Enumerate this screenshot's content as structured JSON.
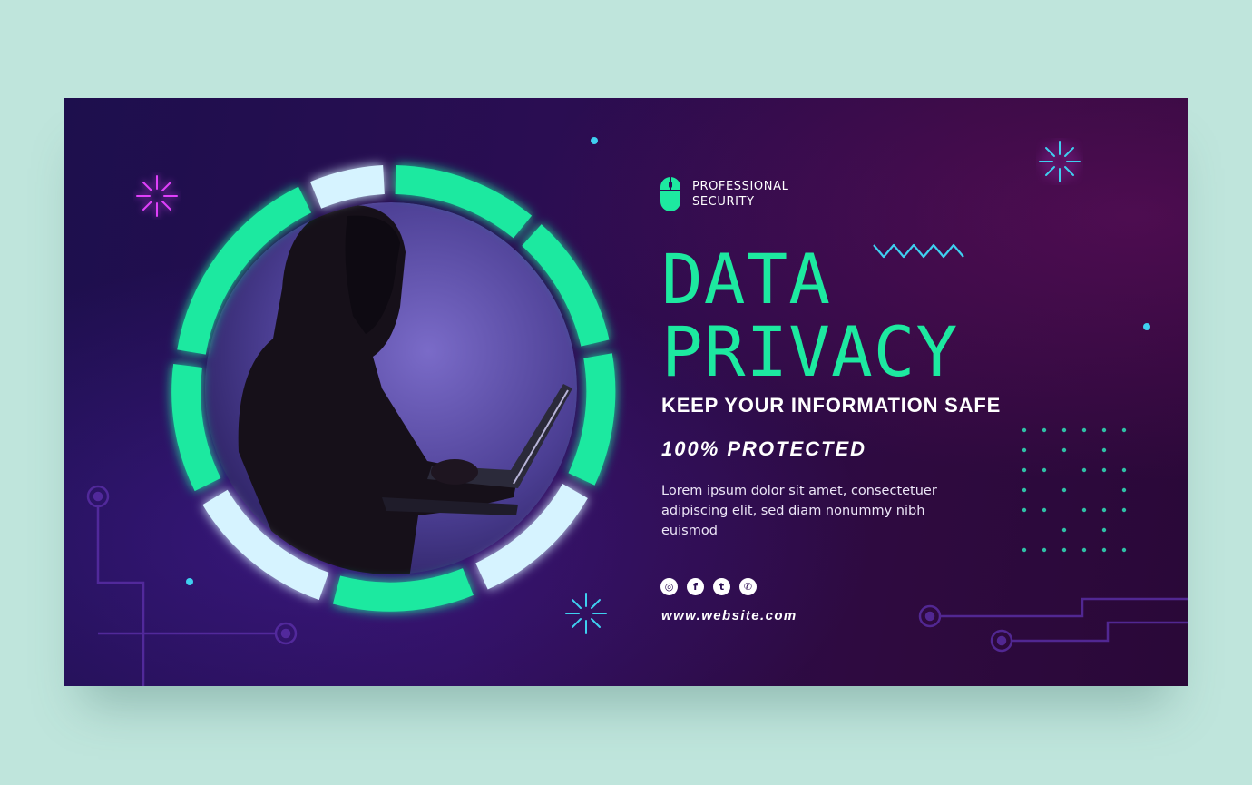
{
  "brand": {
    "name": "PROFESSIONAL SECURITY",
    "icon": "mouse-icon"
  },
  "headline": {
    "line1": "DATA",
    "line2": "PRIVACY"
  },
  "tagline": "KEEP YOUR INFORMATION SAFE",
  "protected_label": "100% PROTECTED",
  "body": "Lorem ipsum dolor sit amet, consectetuer adipiscing elit, sed diam nonummy nibh euismod",
  "socials": [
    {
      "icon": "instagram-icon",
      "glyph": "◎"
    },
    {
      "icon": "facebook-icon",
      "glyph": "f"
    },
    {
      "icon": "twitter-icon",
      "glyph": "t"
    },
    {
      "icon": "whatsapp-icon",
      "glyph": "✆"
    }
  ],
  "website": "www.website.com",
  "colors": {
    "page_background": "#bfe5dc",
    "accent_green": "#1de9a0",
    "accent_light": "#d6f3ff",
    "accent_cyan": "#3fd0f0",
    "accent_magenta": "#e040fb",
    "banner_dark": "#1d0f4d"
  }
}
